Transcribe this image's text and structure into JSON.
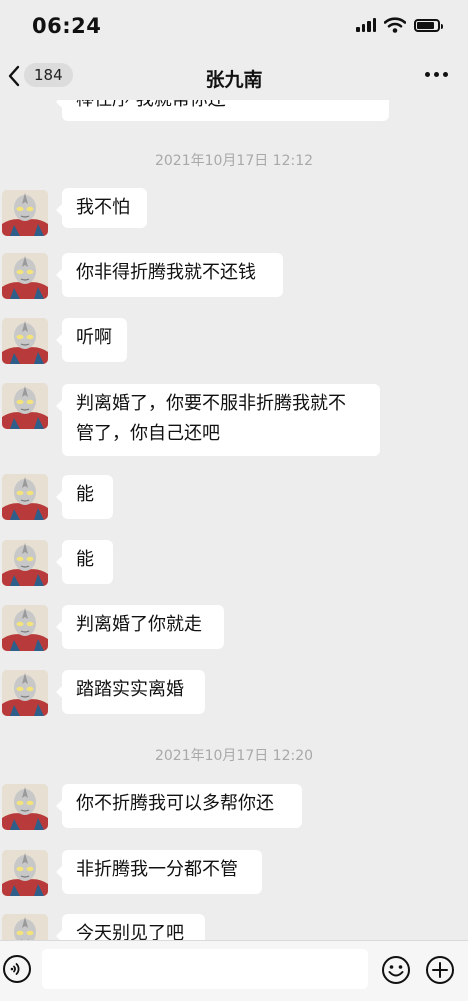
{
  "status_bar": {
    "time": "06:24"
  },
  "nav": {
    "back_count": "184",
    "title": "张九南"
  },
  "chat": {
    "partial_top_message": "棒住序 我就帮你还",
    "timestamps": [
      "2021年10月17日 12:12",
      "2021年10月17日 12:20"
    ],
    "messages": [
      {
        "text": "我不怕"
      },
      {
        "text": "你非得折腾我就不还钱"
      },
      {
        "text": "听啊"
      },
      {
        "line1": "判离婚了，你要不服非折腾我就不",
        "line2": "管了，你自己还吧"
      },
      {
        "text": "能"
      },
      {
        "text": "能"
      },
      {
        "text": "判离婚了你就走"
      },
      {
        "text": "踏踏实实离婚"
      },
      {
        "text": "你不折腾我可以多帮你还"
      },
      {
        "text": "非折腾我一分都不管"
      },
      {
        "text": "今天别见了吧"
      }
    ]
  },
  "input_bar": {
    "value": ""
  },
  "colors": {
    "background": "#ededed",
    "bubble": "#ffffff",
    "timestamp": "#a9a9a9"
  }
}
